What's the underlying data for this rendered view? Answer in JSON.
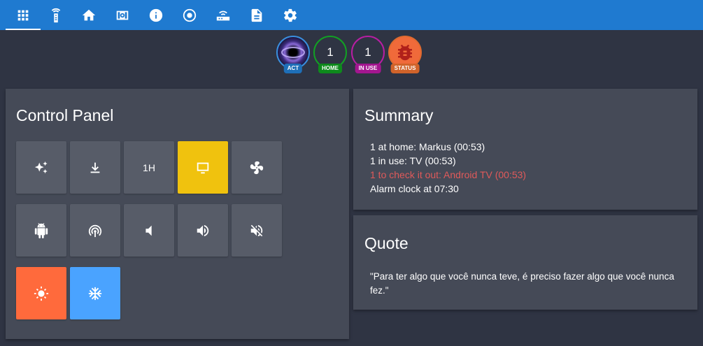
{
  "nav": {
    "tabs": [
      {
        "icon": "apps-grid-icon",
        "active": true
      },
      {
        "icon": "remote-icon"
      },
      {
        "icon": "home-icon"
      },
      {
        "icon": "speaker-icon"
      },
      {
        "icon": "info-icon"
      },
      {
        "icon": "record-icon"
      },
      {
        "icon": "router-icon"
      },
      {
        "icon": "document-icon"
      },
      {
        "icon": "gear-icon"
      }
    ]
  },
  "badges": [
    {
      "value": "",
      "label": "ACT",
      "color": "#1e6fb8"
    },
    {
      "value": "1",
      "label": "HOME",
      "color": "#0e8a1c"
    },
    {
      "value": "1",
      "label": "IN USE",
      "color": "#a3168f"
    },
    {
      "value": "",
      "label": "STATUS",
      "color": "#d0632a"
    }
  ],
  "control_panel": {
    "title": "Control Panel",
    "buttons": [
      {
        "icon": "sparkle-icon"
      },
      {
        "icon": "download-icon"
      },
      {
        "label": "1H"
      },
      {
        "icon": "monitor-icon",
        "color": "#f0c20e"
      },
      {
        "icon": "fan-icon"
      },
      {
        "icon": "android-icon"
      },
      {
        "icon": "broadcast-icon"
      },
      {
        "icon": "volume-low-icon"
      },
      {
        "icon": "volume-high-icon"
      },
      {
        "icon": "volume-mute-icon"
      },
      {
        "icon": "sun-icon",
        "color": "#ff6a3c"
      },
      {
        "icon": "snowflake-icon",
        "color": "#4aa3ff"
      }
    ]
  },
  "summary": {
    "title": "Summary",
    "lines": [
      {
        "text": "1 at home: Markus (00:53)",
        "color": "#ffffff"
      },
      {
        "text": "1 in use: TV (00:53)",
        "color": "#ffffff"
      },
      {
        "text": "1 to check it out: Android TV (00:53)",
        "color": "#e05a5a"
      },
      {
        "text": "Alarm clock at 07:30",
        "color": "#ffffff"
      }
    ]
  },
  "quote": {
    "title": "Quote",
    "text": "\"Para ter algo que você nunca teve, é preciso fazer algo que você nunca fez.\""
  }
}
